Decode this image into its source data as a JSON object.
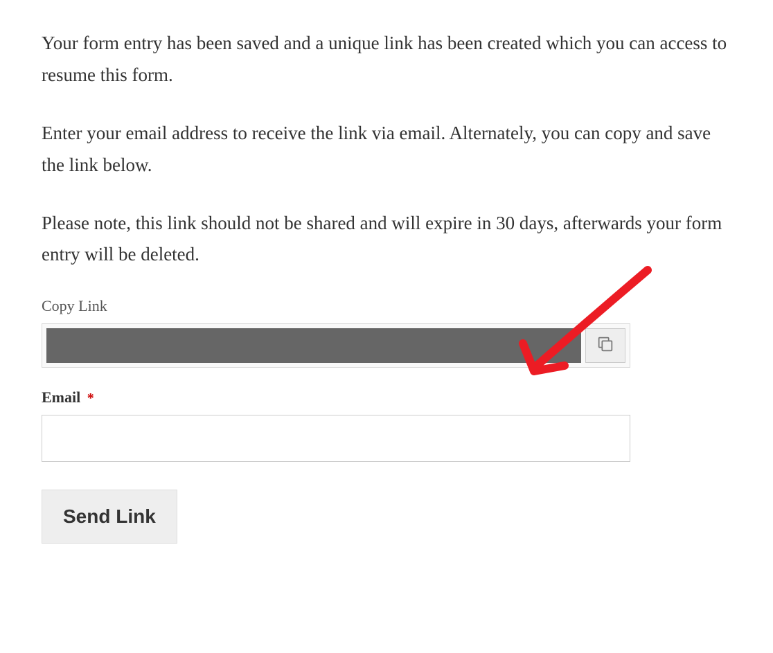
{
  "intro": {
    "paragraph1": "Your form entry has been saved and a unique link has been created which you can access to resume this form.",
    "paragraph2": "Enter your email address to receive the link via email. Alternately, you can copy and save the link below.",
    "paragraph3": "Please note, this link should not be shared and will expire in 30 days, afterwards your form entry will be deleted."
  },
  "form": {
    "copyLinkLabel": "Copy Link",
    "emailLabel": "Email",
    "requiredMark": "*",
    "emailValue": "",
    "sendButtonLabel": "Send Link"
  }
}
